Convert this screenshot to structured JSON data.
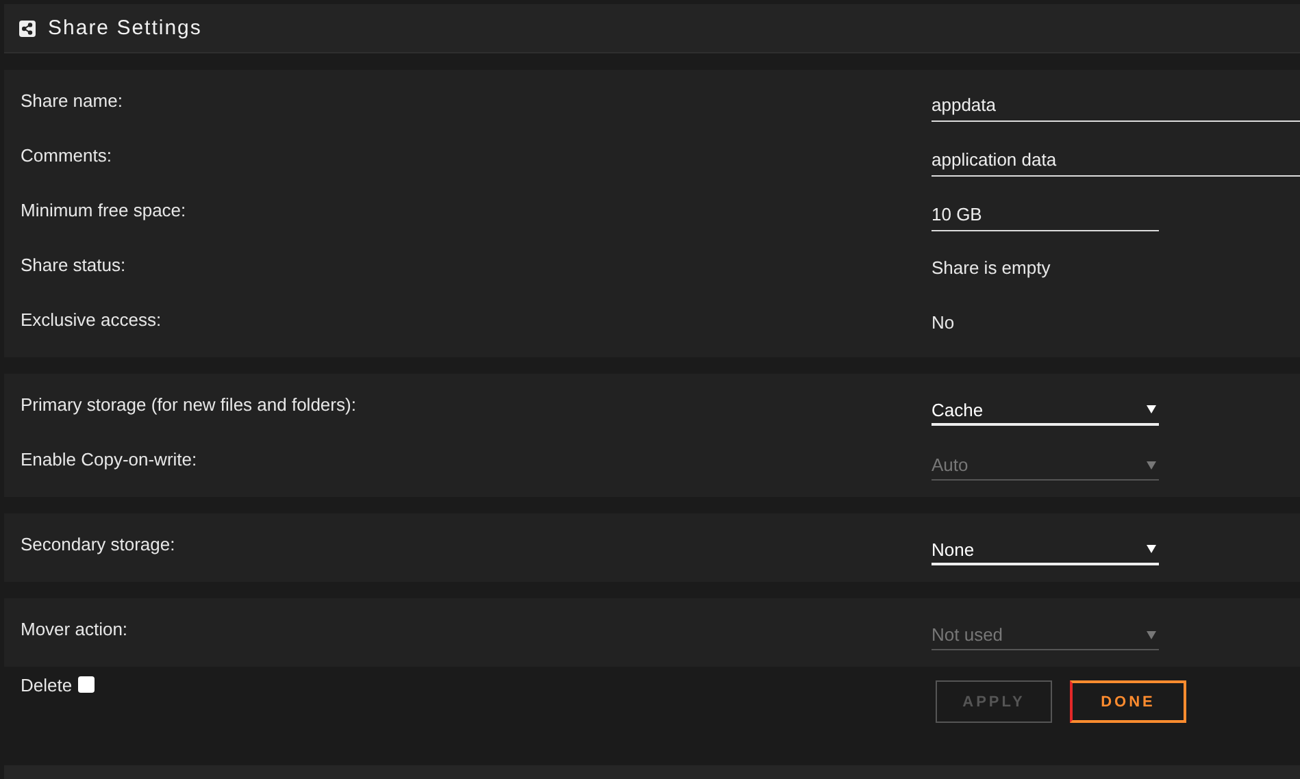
{
  "header": {
    "title": "Share Settings"
  },
  "sections": [
    {
      "rows": [
        {
          "label": "Share name:",
          "kind": "wideinput",
          "value": "appdata"
        },
        {
          "label": "Comments:",
          "kind": "wideinput",
          "value": "application data"
        },
        {
          "label": "Minimum free space:",
          "kind": "input",
          "value": "10 GB"
        },
        {
          "label": "Share status:",
          "kind": "text",
          "value": "Share is empty"
        },
        {
          "label": "Exclusive access:",
          "kind": "text",
          "value": "No"
        }
      ]
    },
    {
      "rows": [
        {
          "label": "Primary storage (for new files and folders):",
          "kind": "select",
          "value": "Cache",
          "disabled": false
        },
        {
          "label": "Enable Copy-on-write:",
          "kind": "select",
          "value": "Auto",
          "disabled": true
        }
      ]
    },
    {
      "rows": [
        {
          "label": "Secondary storage:",
          "kind": "select",
          "value": "None",
          "disabled": false
        }
      ]
    },
    {
      "rows": [
        {
          "label": "Mover action:",
          "kind": "select",
          "value": "Not used",
          "disabled": true
        }
      ]
    }
  ],
  "delete": {
    "label": "Delete",
    "checked": false
  },
  "buttons": [
    {
      "label": "APPLY",
      "disabled": true
    },
    {
      "label": "DONE",
      "disabled": false
    }
  ]
}
